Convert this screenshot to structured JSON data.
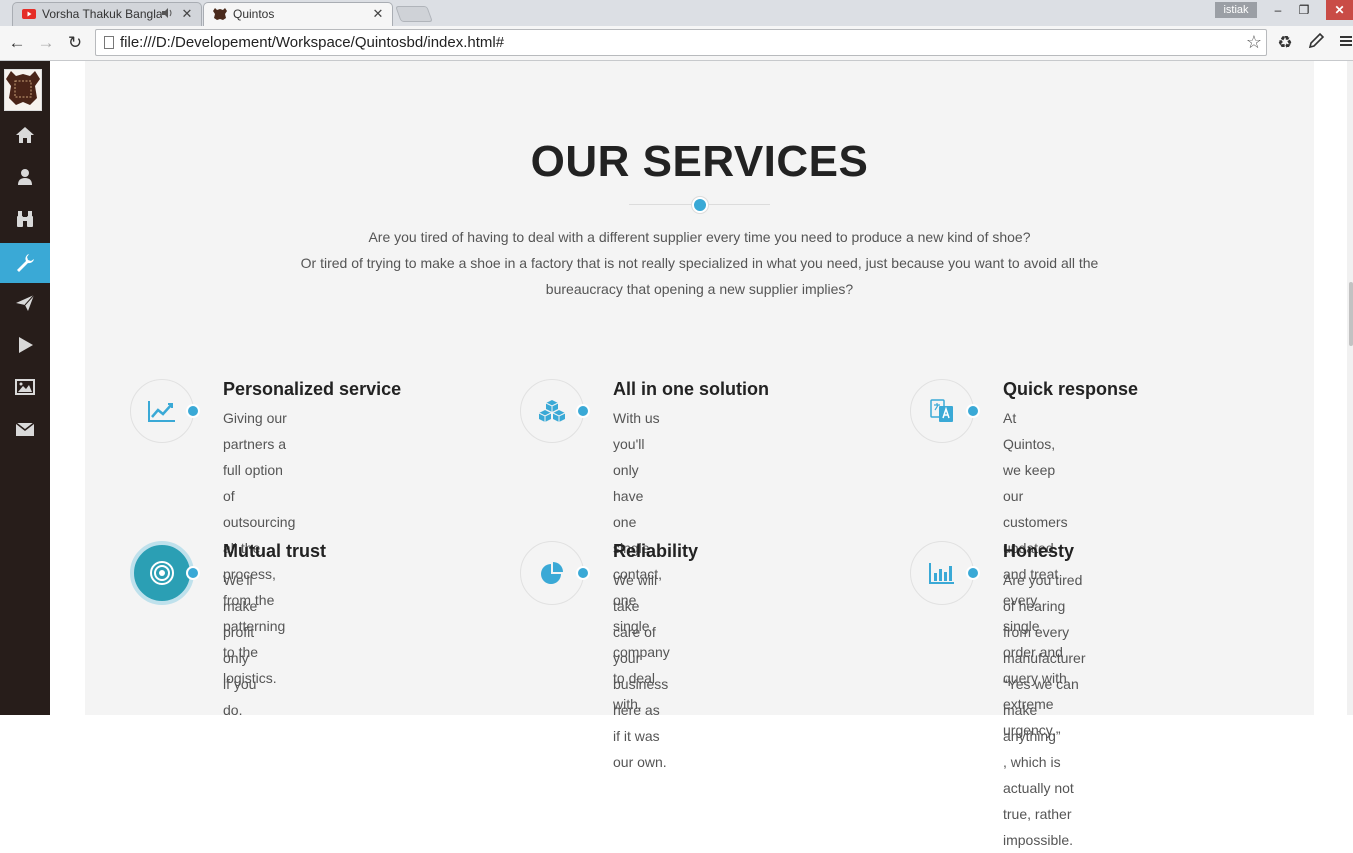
{
  "browser": {
    "tabs": [
      {
        "title": "Vorsha Thakuk Bangla",
        "favicon": "youtube-icon",
        "audio": "speaker-icon"
      },
      {
        "title": "Quintos",
        "favicon": "leather-icon"
      }
    ],
    "user": "istiak",
    "window_controls": {
      "minimize": "–",
      "restore": "❐",
      "close": "✕"
    },
    "url": "file:///D:/Developement/Workspace/Quintosbd/index.html#",
    "nav_icons": {
      "back": "←",
      "forward": "→",
      "reload": "↻"
    },
    "toolbar_icons": [
      "star-icon",
      "recycle-icon",
      "pen-icon",
      "menu-icon"
    ]
  },
  "sidebar": {
    "logo": "leather-logo",
    "items": [
      {
        "icon": "home-icon",
        "active": false
      },
      {
        "icon": "user-icon",
        "active": false
      },
      {
        "icon": "binoculars-icon",
        "active": false
      },
      {
        "icon": "wrench-icon",
        "active": true
      },
      {
        "icon": "paper-plane-icon",
        "active": false
      },
      {
        "icon": "play-icon",
        "active": false
      },
      {
        "icon": "image-icon",
        "active": false
      },
      {
        "icon": "envelope-icon",
        "active": false
      }
    ]
  },
  "section": {
    "title": "OUR SERVICES",
    "intro": [
      "Are you tired of having to deal with a different supplier every time you need to produce a new kind of shoe?",
      "Or tired of trying to make a shoe in a factory that is not really specialized in what you need, just because you want to avoid all the",
      "bureaucracy that opening a new supplier implies?"
    ],
    "services": [
      {
        "name": "Personalized service",
        "icon": "line-chart-icon",
        "desc": [
          "Giving our partners a full option of",
          "outsourcing all the process, from the",
          "patterning to the logistics."
        ]
      },
      {
        "name": "All in one solution",
        "icon": "cubes-icon",
        "desc": [
          "With us you'll only have one single contact,",
          "one single company to deal with."
        ]
      },
      {
        "name": "Quick response",
        "icon": "translate-icon",
        "desc": [
          "At Quintos, we keep our customers",
          "updated and treat every single order and",
          "query with extreme urgency."
        ]
      },
      {
        "name": "Mutual trust",
        "icon": "target-icon",
        "desc": [
          "We'll make profit only if you do."
        ]
      },
      {
        "name": "Reliability",
        "icon": "pie-chart-icon",
        "desc": [
          "We will take care of your business here as",
          "if it was our own."
        ]
      },
      {
        "name": "Honesty",
        "icon": "bar-chart-icon",
        "desc": [
          "Are you tired of hearing from every",
          "manufacturer “Yes we can make anything”",
          ", which is actually not true, rather",
          "impossible."
        ]
      }
    ]
  },
  "colors": {
    "accent": "#3aa9d6",
    "sidebar_bg": "#271d1a",
    "section_bg": "#f4f4f4",
    "highlight_circle": "#2b9fb4"
  }
}
